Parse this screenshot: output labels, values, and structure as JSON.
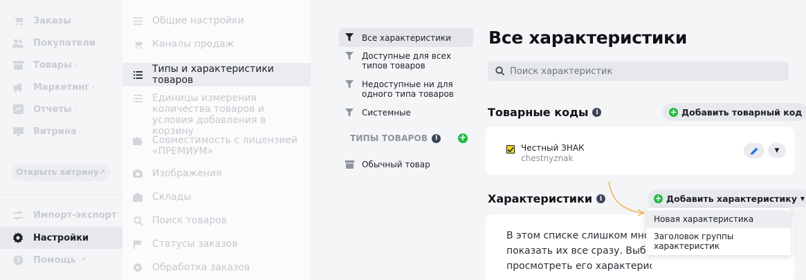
{
  "main_nav": {
    "items": [
      {
        "label": "Заказы",
        "icon": "cart-icon",
        "active": false
      },
      {
        "label": "Покупатели",
        "icon": "users-icon",
        "active": false
      },
      {
        "label": "Товары",
        "icon": "box-icon",
        "active": false,
        "has_submenu": true
      },
      {
        "label": "Маркетинг",
        "icon": "megaphone-icon",
        "active": false,
        "has_submenu": true
      },
      {
        "label": "Отчеты",
        "icon": "chart-icon",
        "active": false,
        "has_submenu": true
      },
      {
        "label": "Витрина",
        "icon": "storefront-icon",
        "active": false,
        "has_submenu": true
      }
    ],
    "storefront_button": "Открыть витрину",
    "bottom_items": [
      {
        "label": "Импорт-экспорт",
        "icon": "swap-icon",
        "active": false
      },
      {
        "label": "Настройки",
        "icon": "gear-icon",
        "active": true
      },
      {
        "label": "Помощь",
        "icon": "help-icon",
        "active": false
      }
    ]
  },
  "settings_nav": {
    "items": [
      {
        "label": "Общие настройки",
        "icon": "list-icon",
        "active": false
      },
      {
        "label": "Каналы продаж",
        "icon": "cart-icon",
        "active": false
      },
      {
        "label": "Типы и характеристики товаров",
        "icon": "list-icon",
        "active": true
      },
      {
        "label": "Единицы измерения количества товаров и условия добавления в корзину",
        "icon": "list-icon",
        "active": false
      },
      {
        "label": "Совместимость с лицензией «ПРЕМИУМ»",
        "icon": "puzzle-icon",
        "active": false
      },
      {
        "label": "Изображения",
        "icon": "camera-icon",
        "active": false
      },
      {
        "label": "Склады",
        "icon": "warehouse-icon",
        "active": false
      },
      {
        "label": "Поиск товаров",
        "icon": "search-icon",
        "active": false
      },
      {
        "label": "Статусы заказов",
        "icon": "flag-icon",
        "active": false
      },
      {
        "label": "Обработка заказов",
        "icon": "cog-icon",
        "active": false
      }
    ]
  },
  "filters": {
    "items": [
      {
        "label": "Все характеристики",
        "active": true
      },
      {
        "label": "Доступные для всех типов товаров",
        "active": false
      },
      {
        "label": "Недоступные ни для одного типа товаров",
        "active": false
      },
      {
        "label": "Системные",
        "active": false
      }
    ],
    "types_heading": "ТИПЫ ТОВАРОВ",
    "types": [
      {
        "label": "Обычный товар"
      }
    ]
  },
  "main": {
    "title": "Все характеристики",
    "search_placeholder": "Поиск характеристик",
    "product_codes": {
      "title": "Товарные коды",
      "add_button": "Добавить товарный код",
      "items": [
        {
          "name": "Честный ЗНАК",
          "code": "chestnyznak"
        }
      ]
    },
    "characteristics": {
      "title": "Характеристики",
      "add_button": "Добавить характеристику",
      "notice_lines": [
        "В этом списке слишком много х",
        "показать их все сразу. Выберит",
        "просмотреть его характеристики."
      ]
    },
    "dropdown": {
      "items": [
        "Новая характеристика",
        "Заголовок группы характеристик"
      ]
    }
  },
  "colors": {
    "accent_green": "#21b841",
    "arrow_orange": "#f3b45a",
    "edit_blue": "#1a73e8"
  }
}
